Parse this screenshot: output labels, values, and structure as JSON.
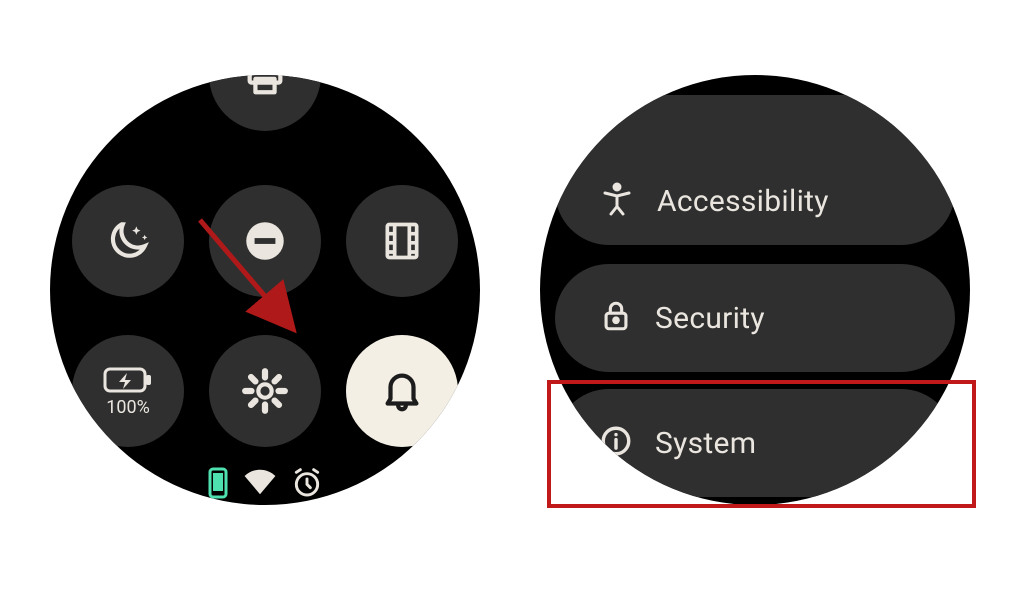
{
  "watch1": {
    "battery_label": "100%",
    "tiles": {
      "top": "printer-icon",
      "dnd": "bedtime-icon",
      "minus": "do-not-disturb-icon",
      "theater": "theater-icon",
      "battery": "battery-icon",
      "gear": "settings-icon",
      "bell": "notifications-icon"
    },
    "status": {
      "phone": "phone-connected-icon",
      "wifi": "wifi-icon",
      "alarm": "alarm-icon"
    }
  },
  "watch2": {
    "items": [
      {
        "icon": "accessibility-icon",
        "label": "Accessibility"
      },
      {
        "icon": "lock-icon",
        "label": "Security"
      },
      {
        "icon": "info-icon",
        "label": "System"
      }
    ]
  },
  "annotations": {
    "arrow_color": "#b01919",
    "highlight_color": "#c11919"
  }
}
